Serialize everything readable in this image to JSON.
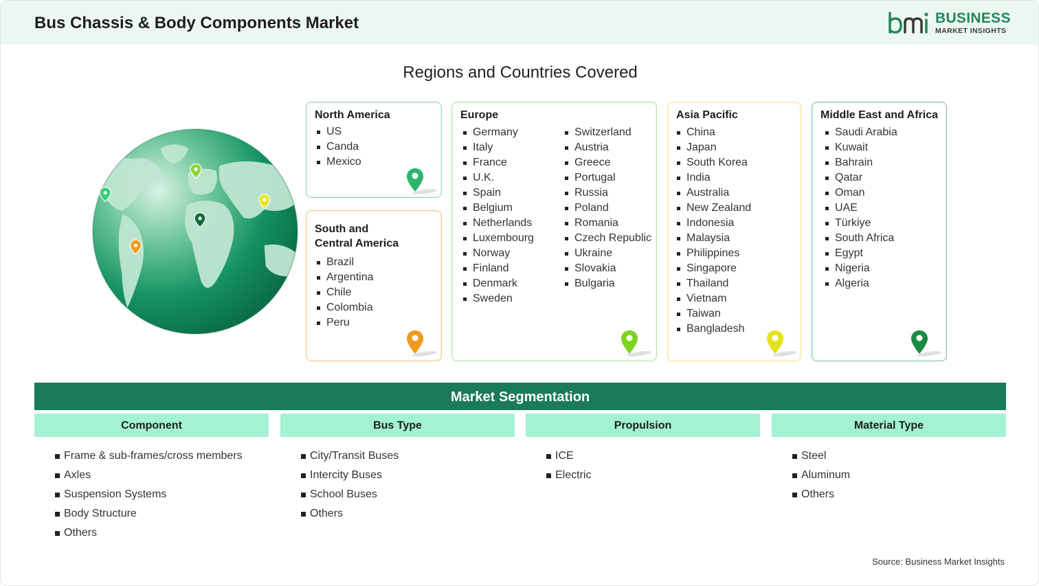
{
  "header": {
    "title": "Bus Chassis & Body Components Market",
    "logo_word1": "BUSINESS",
    "logo_word2": "MARKET INSIGHTS",
    "logo_mark_text": "bmi"
  },
  "regions": {
    "title": "Regions and Countries Covered",
    "north_america": {
      "title": "North America",
      "items": [
        "US",
        "Canda",
        "Mexico"
      ],
      "pin_color": "#2bb56a"
    },
    "south_central_america": {
      "title_line1": "South and",
      "title_line2": "Central America",
      "items": [
        "Brazil",
        "Argentina",
        "Chile",
        "Colombia",
        "Peru"
      ],
      "pin_color": "#f39a1e"
    },
    "europe": {
      "title": "Europe",
      "col1": [
        "Germany",
        "Italy",
        "France",
        "U.K.",
        "Spain",
        "Belgium",
        "Netherlands",
        "Luxembourg",
        "Norway",
        "Finland",
        "Denmark",
        "Sweden"
      ],
      "col2": [
        "Switzerland",
        "Austria",
        "Greece",
        "Portugal",
        "Russia",
        "Poland",
        "Romania",
        "Czech Republic",
        "Ukraine",
        "Slovakia",
        "Bulgaria"
      ],
      "pin_color": "#7ed321"
    },
    "asia_pacific": {
      "title": "Asia Pacific",
      "items": [
        "China",
        "Japan",
        "South Korea",
        "India",
        "Australia",
        "New Zealand",
        "Indonesia",
        "Malaysia",
        "Philippines",
        "Singapore",
        "Thailand",
        "Vietnam",
        "Taiwan",
        "Bangladesh"
      ],
      "pin_color": "#e6e21a"
    },
    "mea": {
      "title": "Middle East and Africa",
      "items": [
        "Saudi Arabia",
        "Kuwait",
        "Bahrain",
        "Qatar",
        "Oman",
        "UAE",
        "Türkiye",
        "South Africa",
        "Egypt",
        "Nigeria",
        "Algeria"
      ],
      "pin_color": "#1a8a45"
    }
  },
  "segmentation": {
    "title": "Market Segmentation",
    "columns": [
      {
        "heading": "Component",
        "items": [
          "Frame & sub-frames/cross members",
          "Axles",
          "Suspension Systems",
          "Body Structure",
          "Others"
        ]
      },
      {
        "heading": "Bus Type",
        "items": [
          "City/Transit Buses",
          "Intercity Buses",
          "School Buses",
          "Others"
        ]
      },
      {
        "heading": "Propulsion",
        "items": [
          "ICE",
          "Electric"
        ]
      },
      {
        "heading": "Material Type",
        "items": [
          "Steel",
          "Aluminum",
          "Others"
        ]
      }
    ]
  },
  "source": "Source: Business Market Insights",
  "colors": {
    "header_bg": "#edf7f1",
    "segment_bar": "#1a7a5a",
    "segment_head": "#a3f2d3",
    "globe_dark": "#0f8a55",
    "globe_light": "#dff3e8"
  }
}
